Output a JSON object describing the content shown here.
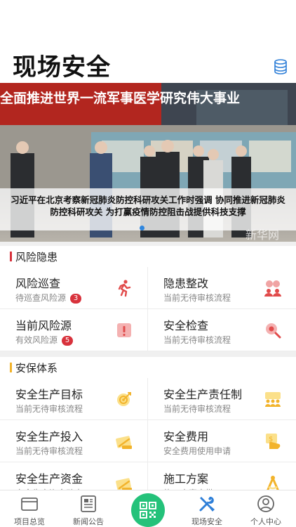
{
  "header": {
    "title": "现场安全"
  },
  "banner": {
    "caption": "习近平在北京考察新冠肺炎防控科研攻关工作时强调 协同推进新冠肺炎防控科研攻关 为打赢疫情防控阻击战提供科技支撑",
    "sign_text": "全面推进世界一流军事医学研究伟大事业",
    "watermark": "新华网"
  },
  "sections": [
    {
      "label": "风险隐患",
      "accent": "#d8323c",
      "cards": [
        {
          "title": "风险巡查",
          "sub": "待巡查风险源",
          "badge": "3",
          "icon": "runner-icon"
        },
        {
          "title": "隐患整改",
          "sub": "当前无待审核流程",
          "badge": null,
          "icon": "people-warning-icon"
        },
        {
          "title": "当前风险源",
          "sub": "有效风险源",
          "badge": "5",
          "icon": "alert-icon"
        },
        {
          "title": "安全检查",
          "sub": "当前无待审核流程",
          "badge": null,
          "icon": "location-search-icon"
        }
      ]
    },
    {
      "label": "安保体系",
      "accent": "#f2b32b",
      "cards": [
        {
          "title": "安全生产目标",
          "sub": "当前无待审核流程",
          "badge": null,
          "icon": "target-icon"
        },
        {
          "title": "安全生产责任制",
          "sub": "当前无待审核流程",
          "badge": null,
          "icon": "team-icon"
        },
        {
          "title": "安全生产投入",
          "sub": "当前无待审核流程",
          "badge": null,
          "icon": "money-input-icon"
        },
        {
          "title": "安全费用",
          "sub": "安全费用使用申请",
          "badge": null,
          "icon": "fee-icon"
        },
        {
          "title": "安全生产资金",
          "sub": "安全生产资金动态",
          "badge": null,
          "icon": "fund-icon"
        },
        {
          "title": "施工方案",
          "sub": "施工方案审批",
          "badge": null,
          "icon": "compass-icon"
        }
      ]
    }
  ],
  "tabbar": {
    "items": [
      {
        "label": "项目总览",
        "icon": "folder-icon",
        "active": false
      },
      {
        "label": "新闻公告",
        "icon": "news-icon",
        "active": false
      },
      {
        "label": "",
        "icon": "qr-code-icon",
        "active": false
      },
      {
        "label": "现场安全",
        "icon": "tools-icon",
        "active": true
      },
      {
        "label": "个人中心",
        "icon": "user-icon",
        "active": false
      }
    ]
  },
  "colors": {
    "primary": "#2e7fd8",
    "danger": "#d8323c",
    "warning": "#f2b32b",
    "scan": "#24c27a"
  }
}
